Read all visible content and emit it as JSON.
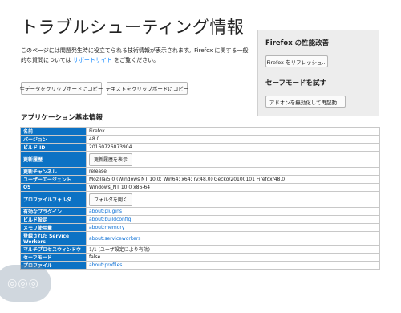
{
  "page": {
    "title": "トラブルシューティング情報",
    "intro_text": "このページには問題発生時に役立てられる技術情報が表示されます。Firefox に関する一般的な質問については ",
    "intro_link": "サポートサイト",
    "intro_suffix": " をご覧ください。"
  },
  "clipboard": {
    "raw_button": "生データをクリップボードにコピー",
    "text_button": "テキストをクリップボードにコピー"
  },
  "sidebar": {
    "performance_heading": "Firefox の性能改善",
    "refresh_button": "Firefox をリフレッシュ...",
    "safe_mode_heading": "セーフモードを試す",
    "restart_button": "アドオンを無効化して再起動..."
  },
  "section": {
    "app_basics_title": "アプリケーション基本情報"
  },
  "table": {
    "rows": [
      {
        "key": "名前",
        "value": "Firefox"
      },
      {
        "key": "バージョン",
        "value": "48.0"
      },
      {
        "key": "ビルド ID",
        "value": "20160726073904"
      },
      {
        "key": "更新履歴",
        "button": "更新履歴を表示"
      },
      {
        "key": "更新チャンネル",
        "value": "release"
      },
      {
        "key": "ユーザーエージェント",
        "value": "Mozilla/5.0 (Windows NT 10.0; Win64; x64; rv:48.0) Gecko/20100101 Firefox/48.0"
      },
      {
        "key": "OS",
        "value": "Windows_NT 10.0 x86-64"
      },
      {
        "key": "プロファイルフォルダ",
        "button": "フォルダを開く"
      },
      {
        "key": "有効なプラグイン",
        "link": "about:plugins"
      },
      {
        "key": "ビルド設定",
        "link": "about:buildconfig"
      },
      {
        "key": "メモリ使用量",
        "link": "about:memory"
      },
      {
        "key": "登録された Service Workers",
        "link": "about:serviceworkers"
      },
      {
        "key": "マルチプロセスウィンドウ",
        "value": "1/1 (ユーザ設定により有効)"
      },
      {
        "key": "セーフモード",
        "value": "false"
      },
      {
        "key": "プロファイル",
        "link": "about:profiles"
      }
    ]
  },
  "colors": {
    "key_cell_bg": "#0c72c4",
    "link": "#0a84ff",
    "side_box_bg": "#ededed"
  }
}
